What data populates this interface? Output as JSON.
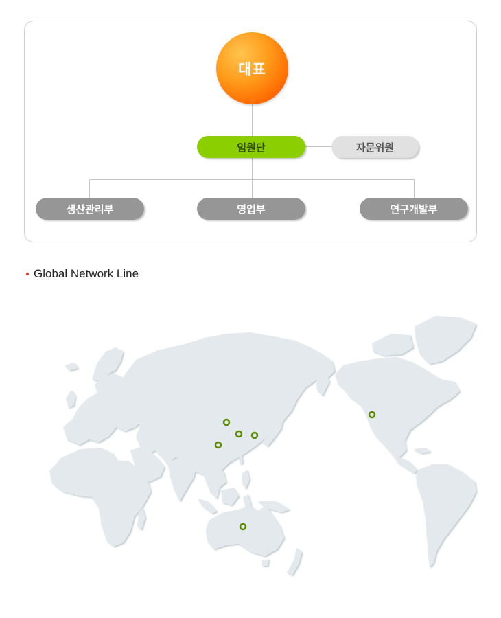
{
  "org_chart": {
    "ceo": "대표",
    "executives": "임원단",
    "advisory": "자문위원",
    "departments": [
      "생산관리부",
      "영업부",
      "연구개발부"
    ]
  },
  "network": {
    "title": "Global Network Line"
  },
  "colors": {
    "ceo_orange": "#ff8a10",
    "executive_green": "#8ccf00",
    "advisory_gray": "#e1e1e1",
    "department_gray": "#969696",
    "marker_green": "#5a8a00",
    "map_land": "#e3e9ec",
    "bullet_red": "#e03a2f"
  }
}
